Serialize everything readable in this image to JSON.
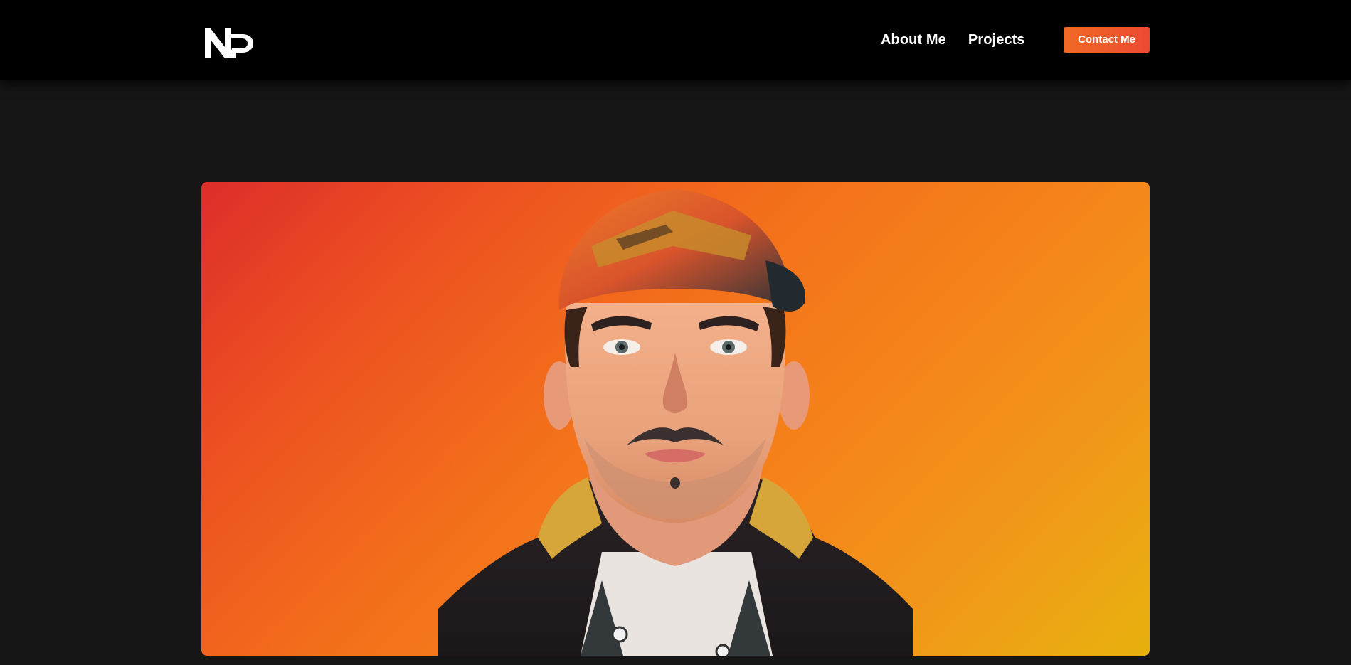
{
  "header": {
    "logo_text": "NP",
    "nav": [
      {
        "label": "About Me"
      },
      {
        "label": "Projects"
      }
    ],
    "contact_label": "Contact Me"
  },
  "hero": {
    "gradient": [
      "#dd2d2a",
      "#f3701b",
      "#e8b20e"
    ],
    "portrait_icon": "avatar-illustration"
  },
  "colors": {
    "header_bg": "#000000",
    "page_bg": "#161616",
    "accent": "#f06a24"
  }
}
